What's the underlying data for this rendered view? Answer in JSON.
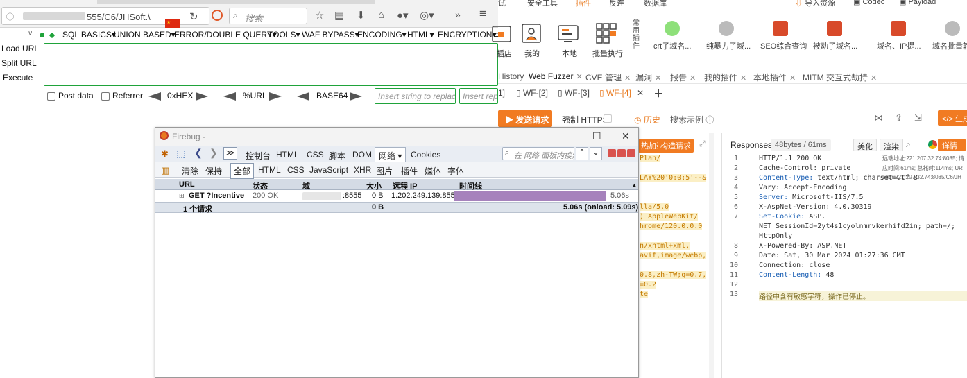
{
  "browser": {
    "url_text": "555/C6/JHSoft.\\",
    "search_placeholder": "搜索",
    "overflow_glyph": "»",
    "menu_glyph": "≡"
  },
  "hackbar": {
    "menus": [
      {
        "label": "SQL BASICS▾"
      },
      {
        "label": "UNION BASED▾"
      },
      {
        "label": "ERROR/DOUBLE QUERY▾"
      },
      {
        "label": "TOOLS▾"
      },
      {
        "label": "WAF BYPASS▾"
      },
      {
        "label": "ENCODING▾"
      },
      {
        "label": "HTML▾"
      },
      {
        "label": "ENCRYPTION▾"
      }
    ],
    "load_url": "Load URL",
    "split_url": "Split URL",
    "execute": "Execute",
    "post_data": "Post data",
    "referrer": "Referrer",
    "hex": "0xHEX",
    "url_enc": "%URL",
    "base64": "BASE64",
    "insert_replace_placeholder": "Insert string to replace",
    "insert_repl2_placeholder": "Insert repl"
  },
  "yakit": {
    "top_partial": [
      "试",
      "安全工具",
      "插件",
      "反连",
      "数据库"
    ],
    "top_right": [
      "导入资源",
      "Codec",
      "Payload"
    ],
    "tools": [
      {
        "label": "插店"
      },
      {
        "label": "我的"
      },
      {
        "label": "本地"
      },
      {
        "label": "批量执行"
      }
    ],
    "vertical_label": "常用插件",
    "plugins": [
      {
        "label": "crt子域名..."
      },
      {
        "label": "纯暴力子域..."
      },
      {
        "label": "SEO综合查询"
      },
      {
        "label": "被动子域名..."
      },
      {
        "label": "域名、IP提..."
      },
      {
        "label": "域名批量转..."
      }
    ],
    "tabs": [
      {
        "label": "History"
      },
      {
        "label": "Web Fuzzer"
      },
      {
        "label": "CVE 管理"
      },
      {
        "label": "漏洞"
      },
      {
        "label": "报告"
      },
      {
        "label": "我的插件"
      },
      {
        "label": "本地插件"
      },
      {
        "label": "MITM 交互式劫持"
      }
    ],
    "wf_tabs": [
      {
        "label": "1]"
      },
      {
        "label": "WF-[2]"
      },
      {
        "label": "WF-[3]"
      },
      {
        "label": "WF-[4]"
      }
    ],
    "send_button": "发送请求",
    "force_https": "强制 HTTPS",
    "history": "历史",
    "search_example": "搜索示例",
    "gen_button": "</> 生成",
    "req_buttons": [
      "热加载",
      "构造请求"
    ],
    "request_lines": [
      "Plan/",
      "LAY%20'0:0:5'--&",
      "lla/5.0",
      ") AppleWebKit/",
      "hrome/120.0.0.0",
      "n/xhtml+xml,",
      "avif,image/webp,",
      "0.8,zh-TW;q=0.7,",
      "=0.2",
      "te"
    ],
    "responses_title": "Responses",
    "responses_meta": "48bytes / 61ms",
    "beautify": "美化",
    "render": "渲染",
    "details": "详情",
    "remote_info": [
      "远端地址:221.207.32.74:8085; 请",
      "应时间:61ms; 总耗时:114ms; UR",
      "addr:221.207.32.74:8085/C6/JH"
    ],
    "response_lines": [
      {
        "n": "1",
        "key": "",
        "text": "HTTP/1.1 200 OK"
      },
      {
        "n": "2",
        "key": "",
        "text": "Cache-Control: private"
      },
      {
        "n": "3",
        "key": "Content-Type:",
        "text": " text/html; charset=utf-8"
      },
      {
        "n": "4",
        "key": "",
        "text": "Vary: Accept-Encoding"
      },
      {
        "n": "5",
        "key": "Server:",
        "text": " Microsoft-IIS/7.5"
      },
      {
        "n": "6",
        "key": "",
        "text": "X-AspNet-Version: 4.0.30319"
      },
      {
        "n": "7",
        "key": "Set-Cookie:",
        "text": " ASP."
      },
      {
        "n": "",
        "key": "",
        "text": "NET_SessionId=2yt4s1cyolnmrvkerhifd2in; path=/;"
      },
      {
        "n": "",
        "key": "",
        "text": "HttpOnly"
      },
      {
        "n": "8",
        "key": "",
        "text": "X-Powered-By: ASP.NET"
      },
      {
        "n": "9",
        "key": "",
        "text": "Date: Sat, 30 Mar 2024 01:27:36 GMT"
      },
      {
        "n": "10",
        "key": "",
        "text": "Connection: close"
      },
      {
        "n": "11",
        "key": "Content-Length:",
        "text": " 48"
      },
      {
        "n": "12",
        "key": "",
        "text": ""
      },
      {
        "n": "13",
        "key": "",
        "text": "路径中含有敏感字符，操作已停止。"
      }
    ]
  },
  "firebug": {
    "title": "Firebug -",
    "toolbar": [
      "控制台",
      "HTML",
      "CSS",
      "脚本",
      "DOM",
      "网络 ▾",
      "Cookies"
    ],
    "search_placeholder": "在 网络 面板内搜索",
    "subtabs": [
      "清除",
      "保持",
      "全部",
      "HTML",
      "CSS",
      "JavaScript",
      "XHR",
      "图片",
      "插件",
      "媒体",
      "字体"
    ],
    "headers": [
      "URL",
      "状态",
      "域",
      "大小",
      "远程 IP",
      "时间线"
    ],
    "row": {
      "url": "GET ?Incentive",
      "status": "200 OK",
      "domain": ":8555",
      "size": "0 B",
      "remote_ip": "1.202.249.139:8555",
      "time": "5.06s",
      "progress": 1.0
    },
    "summary": {
      "count": "1 个请求",
      "size": "0 B",
      "time": "5.06s (onload: 5.09s)"
    }
  },
  "colors": {
    "hackbar_green": "#1fa33a",
    "yakit_orange": "#f17b22",
    "timeline_bar": "#a682bc"
  }
}
